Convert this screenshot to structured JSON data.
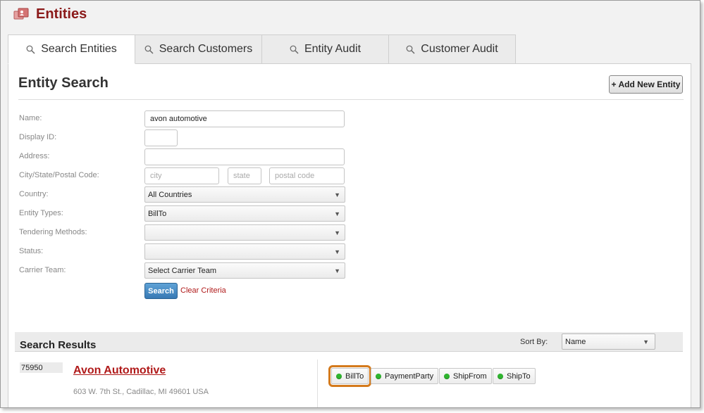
{
  "app": {
    "title": "Entities"
  },
  "tabs": [
    {
      "label": "Search Entities",
      "active": true
    },
    {
      "label": "Search Customers",
      "active": false
    },
    {
      "label": "Entity Audit",
      "active": false
    },
    {
      "label": "Customer Audit",
      "active": false
    }
  ],
  "panel": {
    "heading": "Entity Search",
    "add_button_label": "+ Add New Entity"
  },
  "form": {
    "name": {
      "label": "Name:",
      "value": "avon automotive"
    },
    "display_id": {
      "label": "Display ID:",
      "value": ""
    },
    "address": {
      "label": "Address:",
      "value": ""
    },
    "city_state_postal": {
      "label": "City/State/Postal Code:",
      "city_placeholder": "city",
      "state_placeholder": "state",
      "postal_placeholder": "postal code"
    },
    "country": {
      "label": "Country:",
      "value": "All Countries"
    },
    "entity_types": {
      "label": "Entity Types:",
      "value": "BillTo"
    },
    "tendering_methods": {
      "label": "Tendering Methods:",
      "value": ""
    },
    "status": {
      "label": "Status:",
      "value": ""
    },
    "carrier_team": {
      "label": "Carrier Team:",
      "value": "Select Carrier Team"
    },
    "search_label": "Search",
    "clear_label": "Clear Criteria"
  },
  "results": {
    "title": "Search Results",
    "sort_by_label": "Sort By:",
    "sort_by_value": "Name",
    "items": [
      {
        "id": "75950",
        "name": "Avon Automotive",
        "address": "603 W. 7th St., Cadillac, MI 49601 USA",
        "tags": [
          "BillTo",
          "PaymentParty",
          "ShipFrom",
          "ShipTo"
        ]
      }
    ]
  },
  "colors": {
    "accent": "#8b1a1a",
    "link": "#b01a1a",
    "button_blue": "#3879b4",
    "status_dot": "#2fb52f",
    "highlight": "#d47a1c"
  },
  "icons": {
    "title": "entities-icon",
    "tab": "search-icon",
    "dropdown": "chevron-down-icon",
    "tag": "status-dot-icon"
  }
}
